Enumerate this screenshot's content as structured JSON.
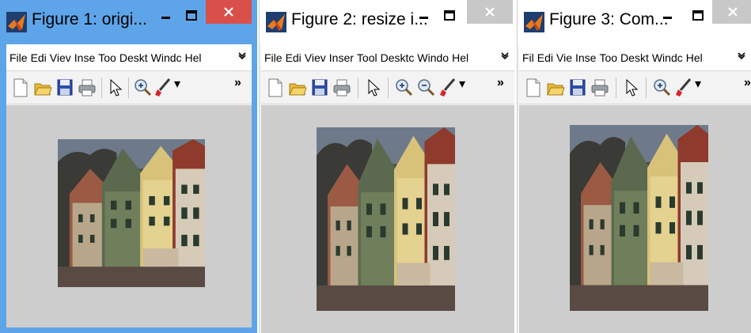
{
  "figures": [
    {
      "title": "Figure 1: origi...",
      "menu": [
        "File",
        "Edi",
        "Viev",
        "Inse",
        "Too",
        "Deskt",
        "Windc",
        "Hel"
      ]
    },
    {
      "title": "Figure 2: resize i...",
      "menu": [
        "File",
        "Edi",
        "Viev",
        "Inser",
        "Tool",
        "Desktc",
        "Windo",
        "Hel"
      ]
    },
    {
      "title": "Figure 3: Com...",
      "menu": [
        "Fil",
        "Edi",
        "Vie",
        "Inse",
        "Too",
        "Deskt",
        "Windc",
        "Hel"
      ]
    }
  ],
  "icons": {
    "app": "matlab-icon",
    "minimize": "minimize-icon",
    "maximize": "maximize-icon",
    "close": "close-icon",
    "menu_overflow": "menu-overflow-icon",
    "toolbar": [
      "new-figure-icon",
      "open-file-icon",
      "save-icon",
      "print-icon",
      "pointer-icon",
      "zoom-in-icon",
      "zoom-out-icon",
      "brush-icon",
      "toolbar-overflow-icon"
    ]
  },
  "colors": {
    "active_titlebar": "#5ea4e8",
    "close_active": "#d9504a",
    "close_inactive": "#c8c8c8",
    "axes_background": "#cdcdcd"
  }
}
